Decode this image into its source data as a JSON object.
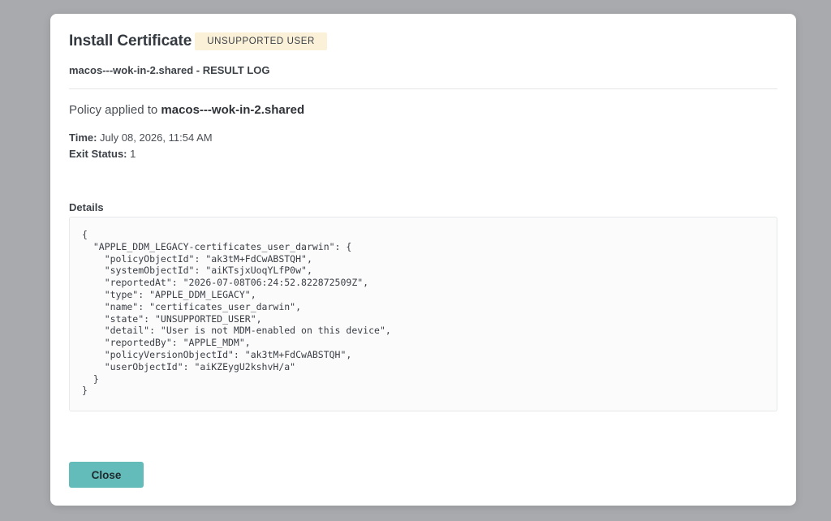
{
  "modal": {
    "title": "Install Certificate",
    "badge": "UNSUPPORTED USER",
    "subtitle": "macos---wok-in-2.shared - RESULT LOG",
    "policy_prefix": "Policy applied to ",
    "policy_host": "macos---wok-in-2.shared",
    "time_label": "Time:",
    "time_value": " July 08, 2026, 11:54 AM",
    "exit_label": "Exit Status:",
    "exit_value": " 1",
    "details_label": "Details",
    "details_json": "{\n  \"APPLE_DDM_LEGACY-certificates_user_darwin\": {\n    \"policyObjectId\": \"ak3tM+FdCwABSTQH\",\n    \"systemObjectId\": \"aiKTsjxUoqYLfP0w\",\n    \"reportedAt\": \"2026-07-08T06:24:52.822872509Z\",\n    \"type\": \"APPLE_DDM_LEGACY\",\n    \"name\": \"certificates_user_darwin\",\n    \"state\": \"UNSUPPORTED_USER\",\n    \"detail\": \"User is not MDM-enabled on this device\",\n    \"reportedBy\": \"APPLE_MDM\",\n    \"policyVersionObjectId\": \"ak3tM+FdCwABSTQH\",\n    \"userObjectId\": \"aiKZEygU2kshvH/a\"\n  }\n}",
    "close_label": "Close"
  },
  "colors": {
    "backdrop": "#a8aaae",
    "badge_bg": "#fbf1d9",
    "close_button": "#63bcb9"
  }
}
